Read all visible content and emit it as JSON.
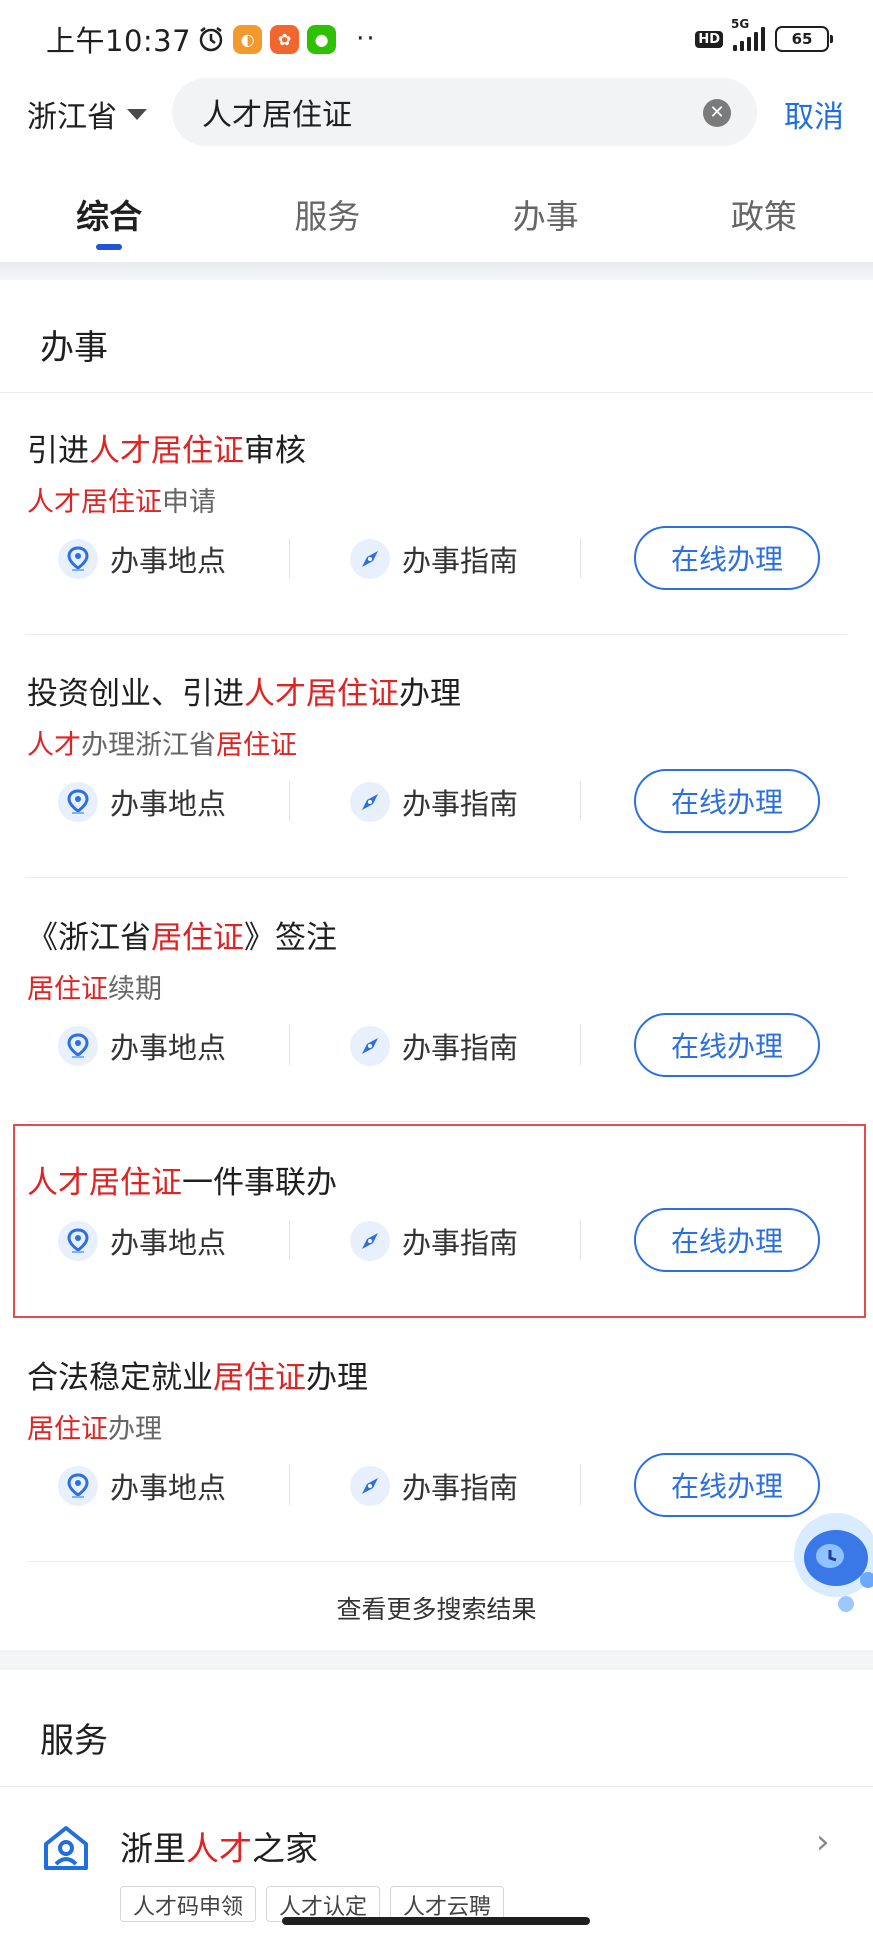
{
  "status_bar": {
    "time": "上午10:37",
    "network": "5G",
    "hd": "HD",
    "battery": "65"
  },
  "search": {
    "province": "浙江省",
    "query": "人才居住证",
    "cancel_label": "取消"
  },
  "tabs": [
    {
      "label": "综合",
      "active": true
    },
    {
      "label": "服务",
      "active": false
    },
    {
      "label": "办事",
      "active": false
    },
    {
      "label": "政策",
      "active": false
    }
  ],
  "affairs_section": {
    "title": "办事",
    "action_location": "办事地点",
    "action_guide": "办事指南",
    "action_online": "在线办理",
    "items": [
      {
        "title_parts": [
          {
            "t": "引进",
            "hl": false
          },
          {
            "t": "人才居住证",
            "hl": true
          },
          {
            "t": "审核",
            "hl": false
          }
        ],
        "sub_parts": [
          {
            "t": "人才居住证",
            "hl": true
          },
          {
            "t": "申请",
            "hl": false
          }
        ]
      },
      {
        "title_parts": [
          {
            "t": "投资创业、引进",
            "hl": false
          },
          {
            "t": "人才居住证",
            "hl": true
          },
          {
            "t": "办理",
            "hl": false
          }
        ],
        "sub_parts": [
          {
            "t": "人才",
            "hl": true
          },
          {
            "t": "办理浙江省",
            "hl": false
          },
          {
            "t": "居住证",
            "hl": true
          }
        ]
      },
      {
        "title_parts": [
          {
            "t": "《浙江省",
            "hl": false
          },
          {
            "t": "居住证",
            "hl": true
          },
          {
            "t": "》签注",
            "hl": false
          }
        ],
        "sub_parts": [
          {
            "t": "居住证",
            "hl": true
          },
          {
            "t": "续期",
            "hl": false
          }
        ]
      },
      {
        "title_parts": [
          {
            "t": "人才居住证",
            "hl": true
          },
          {
            "t": "一件事联办",
            "hl": false
          }
        ],
        "sub_parts": []
      },
      {
        "title_parts": [
          {
            "t": "合法稳定就业",
            "hl": false
          },
          {
            "t": "居住证",
            "hl": true
          },
          {
            "t": "办理",
            "hl": false
          }
        ],
        "sub_parts": [
          {
            "t": "居住证",
            "hl": true
          },
          {
            "t": "办理",
            "hl": false
          }
        ]
      }
    ],
    "more_results": "查看更多搜索结果"
  },
  "service_section": {
    "title": "服务",
    "item_parts": [
      {
        "t": "浙里",
        "hl": false
      },
      {
        "t": "人才",
        "hl": true
      },
      {
        "t": "之家",
        "hl": false
      }
    ],
    "chips": [
      "人才码申领",
      "人才认定",
      "人才云聘"
    ]
  },
  "colors": {
    "highlight": "#e02424",
    "accent": "#2b6fe0",
    "selection_box": "#e64a4a"
  }
}
